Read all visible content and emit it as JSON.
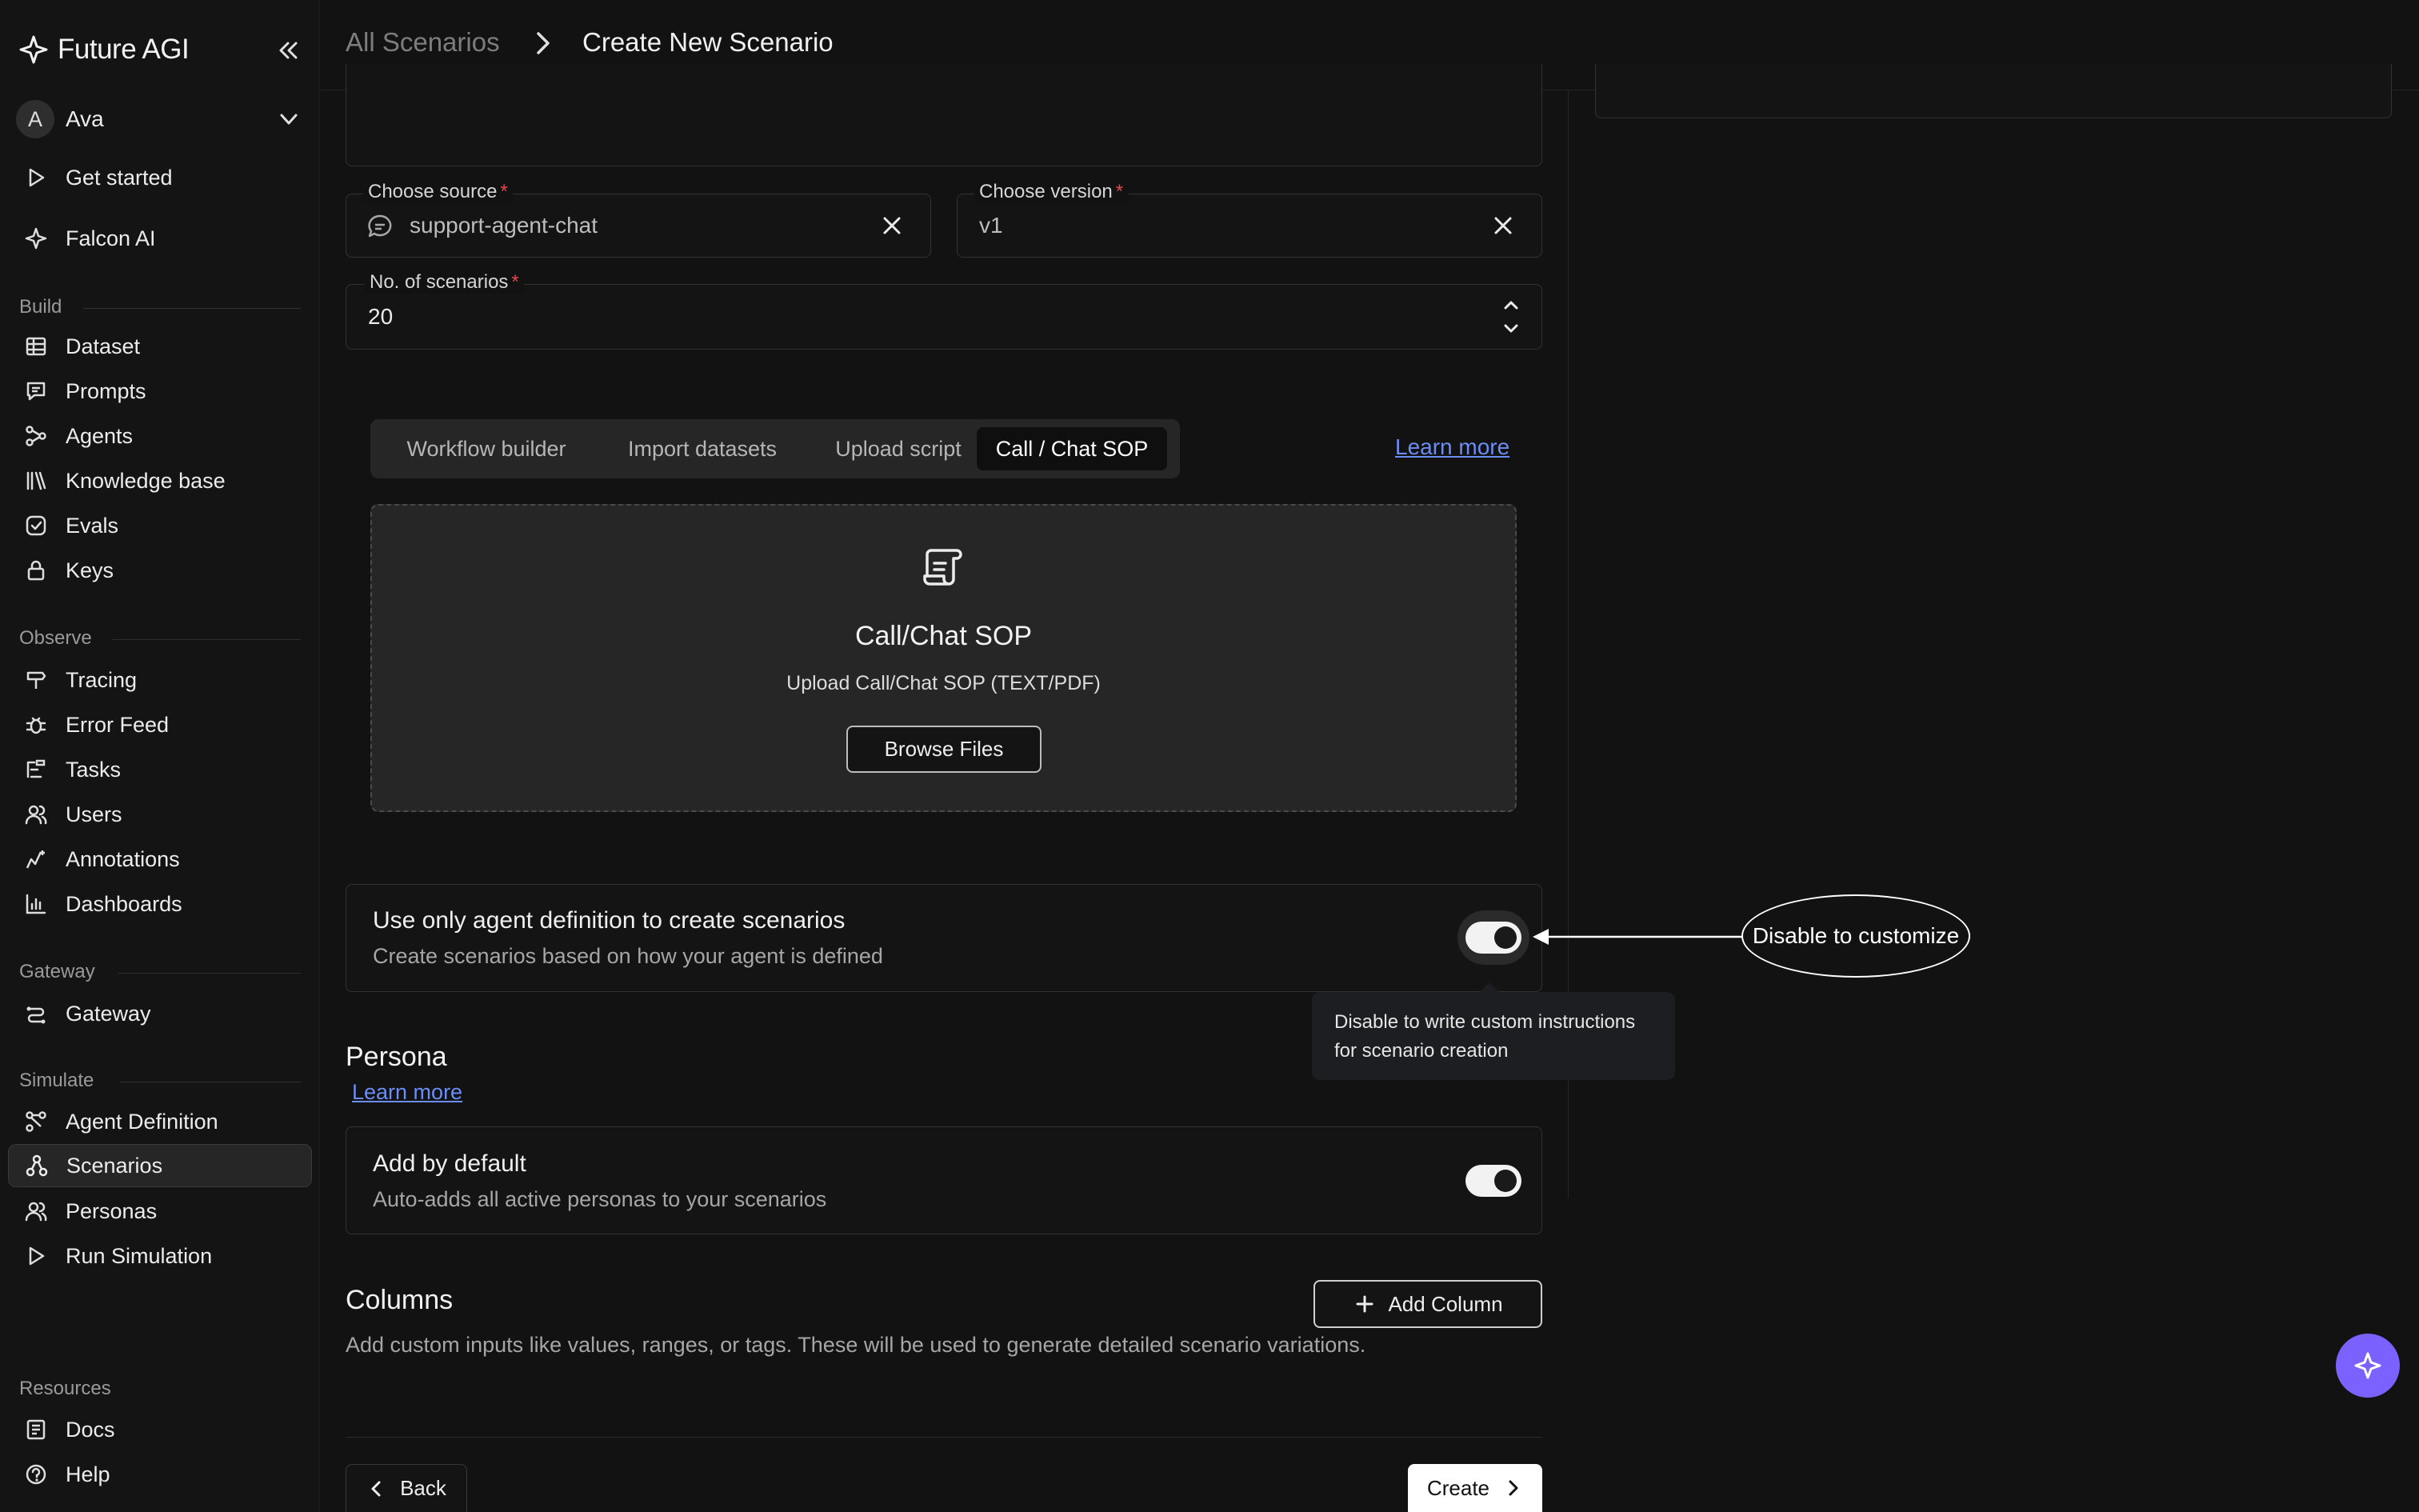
{
  "app": {
    "name": "Future AGI"
  },
  "user": {
    "initial": "A",
    "name": "Ava"
  },
  "nav": {
    "top": [
      {
        "label": "Get started",
        "icon": "play-icon"
      },
      {
        "label": "Falcon AI",
        "icon": "falcon-icon"
      }
    ],
    "sections": [
      {
        "label": "Build",
        "items": [
          "Dataset",
          "Prompts",
          "Agents",
          "Knowledge base",
          "Evals",
          "Keys"
        ]
      },
      {
        "label": "Observe",
        "items": [
          "Tracing",
          "Error Feed",
          "Tasks",
          "Users",
          "Annotations",
          "Dashboards"
        ]
      },
      {
        "label": "Gateway",
        "items": [
          "Gateway"
        ]
      },
      {
        "label": "Simulate",
        "items": [
          "Agent Definition",
          "Scenarios",
          "Personas",
          "Run Simulation"
        ]
      },
      {
        "label": "Resources",
        "items": [
          "Docs",
          "Help"
        ]
      }
    ],
    "active": "Scenarios"
  },
  "breadcrumb": {
    "parent": "All Scenarios",
    "current": "Create New Scenario"
  },
  "form": {
    "source": {
      "label": "Choose source",
      "value": "support-agent-chat"
    },
    "version": {
      "label": "Choose version",
      "value": "v1"
    },
    "count": {
      "label": "No. of scenarios",
      "value": "20"
    },
    "required_mark": "*"
  },
  "tabs": {
    "items": [
      "Workflow builder",
      "Import datasets",
      "Upload script",
      "Call / Chat SOP"
    ],
    "active": "Call / Chat SOP",
    "learn_more": "Learn more"
  },
  "upload": {
    "title": "Call/Chat SOP",
    "subtitle": "Upload Call/Chat SOP (TEXT/PDF)",
    "button": "Browse Files"
  },
  "agent_definition_card": {
    "title": "Use only agent definition to create scenarios",
    "subtitle": "Create scenarios based on how your agent is defined",
    "enabled": true
  },
  "tooltip": {
    "text": "Disable to write custom instructions for scenario creation"
  },
  "callout": {
    "text": "Disable to customize"
  },
  "persona": {
    "heading": "Persona",
    "learn_more": "Learn more",
    "card_title": "Add by default",
    "card_subtitle": "Auto-adds all active personas to your scenarios",
    "enabled": true
  },
  "columns": {
    "heading": "Columns",
    "description": "Add custom inputs like values, ranges, or tags. These will be used to generate detailed scenario variations.",
    "add_button": "Add Column"
  },
  "footer": {
    "back": "Back",
    "create": "Create"
  },
  "colors": {
    "accent": "#7b61ff",
    "link": "#6b8ef5",
    "required": "#e5484d"
  }
}
